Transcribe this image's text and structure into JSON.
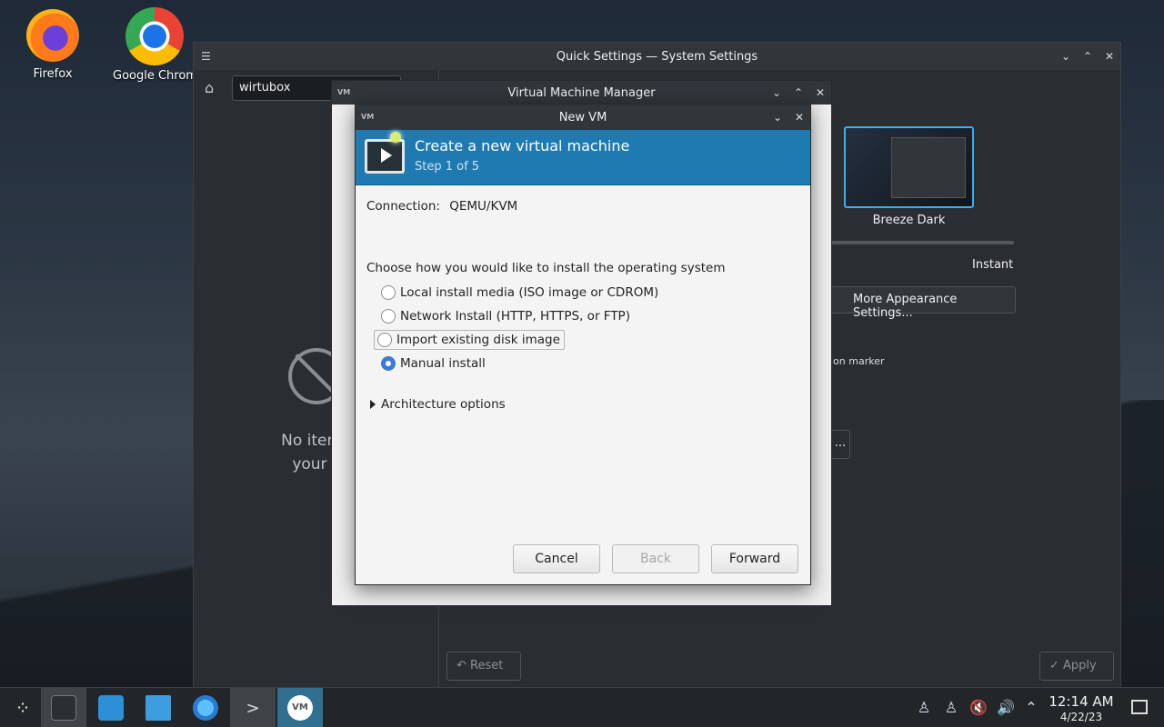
{
  "desktop": {
    "icons": [
      {
        "label": "Firefox",
        "icon": "firefox-icon"
      },
      {
        "label": "Google Chrom",
        "icon": "chrome-icon"
      }
    ]
  },
  "system_settings": {
    "title": "Quick Settings — System Settings",
    "search_value": "wirtubox",
    "no_items_line1": "No items m",
    "no_items_line2": "your sea",
    "theme_name": "Breeze Dark",
    "animation_speed_label": "Instant",
    "more_appearance_button": "More Appearance Settings...",
    "marker_text": "ion marker",
    "dots_button": "...",
    "reset_label": "Reset",
    "apply_label": "Apply",
    "reset_icon": "undo-icon",
    "apply_icon": "check-icon"
  },
  "vmm": {
    "title": "Virtual Machine Manager",
    "badge": "VM"
  },
  "new_vm": {
    "title": "New VM",
    "badge": "VM",
    "banner_title": "Create a new virtual machine",
    "banner_step": "Step 1 of 5",
    "connection_label": "Connection:",
    "connection_value": "QEMU/KVM",
    "choose_prompt": "Choose how you would like to install the operating system",
    "options": [
      {
        "label": "Local install media (ISO image or CDROM)",
        "selected": false
      },
      {
        "label": "Network Install (HTTP, HTTPS, or FTP)",
        "selected": false
      },
      {
        "label": "Import existing disk image",
        "selected": false
      },
      {
        "label": "Manual install",
        "selected": true
      }
    ],
    "arch_options_label": "Architecture options",
    "cancel_label": "Cancel",
    "back_label": "Back",
    "forward_label": "Forward"
  },
  "taskbar": {
    "clock_time": "12:14 AM",
    "clock_date": "4/22/23",
    "vm_badge": "VM",
    "items": [
      {
        "name": "app-launcher-icon"
      },
      {
        "name": "system-settings-icon"
      },
      {
        "name": "discover-store-icon"
      },
      {
        "name": "file-manager-icon"
      },
      {
        "name": "network-globe-icon"
      },
      {
        "name": "terminal-icon"
      },
      {
        "name": "virt-manager-icon"
      }
    ]
  }
}
